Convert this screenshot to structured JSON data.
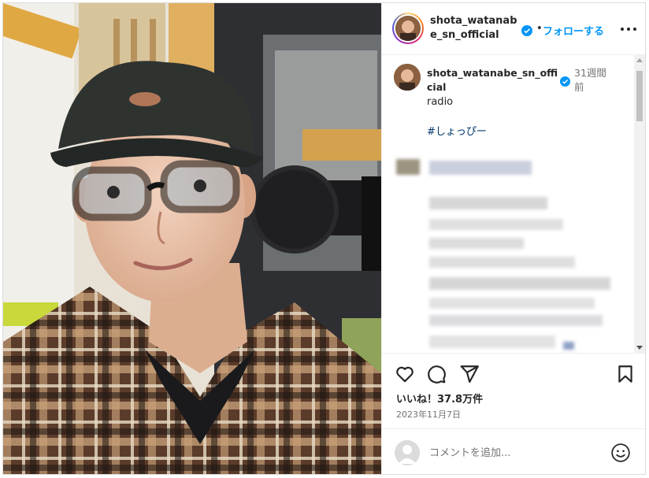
{
  "post": {
    "username": "shota_watanabe_sn_official",
    "follow_label": "フォローする",
    "separator": "•",
    "more_icon": "more-horizontal-icon",
    "verified_icon": "verified-badge-icon"
  },
  "caption": {
    "username": "shota_watanabe_sn_official",
    "time_ago": "31週間前",
    "text": "radio",
    "hashtag": "#しょっぴー"
  },
  "actions": {
    "icons": [
      "heart-icon",
      "comment-icon",
      "share-icon",
      "bookmark-icon"
    ],
    "likes": "いいね！37.8万件",
    "date": "2023年11月7日"
  },
  "comment_box": {
    "placeholder": "コメントを追加...",
    "emoji_icon": "emoji-icon"
  },
  "colors": {
    "accent": "#0095f6",
    "link": "#00376b",
    "muted": "#737373",
    "border": "#dbdbdb"
  }
}
